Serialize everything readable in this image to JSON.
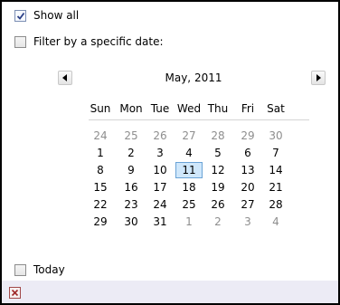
{
  "options": {
    "show_all": {
      "label": "Show all",
      "checked": true
    },
    "filter_by_date": {
      "label": "Filter by a specific date:",
      "checked": false
    },
    "today": {
      "label": "Today",
      "checked": false
    }
  },
  "calendar": {
    "month_label": "May, 2011",
    "weekdays": [
      "Sun",
      "Mon",
      "Tue",
      "Wed",
      "Thu",
      "Fri",
      "Sat"
    ],
    "selected_day": "11",
    "weeks": [
      [
        {
          "d": "24",
          "o": true
        },
        {
          "d": "25",
          "o": true
        },
        {
          "d": "26",
          "o": true
        },
        {
          "d": "27",
          "o": true
        },
        {
          "d": "28",
          "o": true
        },
        {
          "d": "29",
          "o": true
        },
        {
          "d": "30",
          "o": true
        }
      ],
      [
        {
          "d": "1"
        },
        {
          "d": "2"
        },
        {
          "d": "3"
        },
        {
          "d": "4"
        },
        {
          "d": "5"
        },
        {
          "d": "6"
        },
        {
          "d": "7"
        }
      ],
      [
        {
          "d": "8"
        },
        {
          "d": "9"
        },
        {
          "d": "10"
        },
        {
          "d": "11",
          "sel": true
        },
        {
          "d": "12"
        },
        {
          "d": "13"
        },
        {
          "d": "14"
        }
      ],
      [
        {
          "d": "15"
        },
        {
          "d": "16"
        },
        {
          "d": "17"
        },
        {
          "d": "18"
        },
        {
          "d": "19"
        },
        {
          "d": "20"
        },
        {
          "d": "21"
        }
      ],
      [
        {
          "d": "22"
        },
        {
          "d": "23"
        },
        {
          "d": "24"
        },
        {
          "d": "25"
        },
        {
          "d": "26"
        },
        {
          "d": "27"
        },
        {
          "d": "28"
        }
      ],
      [
        {
          "d": "29"
        },
        {
          "d": "30"
        },
        {
          "d": "31"
        },
        {
          "d": "1",
          "o": true
        },
        {
          "d": "2",
          "o": true
        },
        {
          "d": "3",
          "o": true
        },
        {
          "d": "4",
          "o": true
        }
      ]
    ]
  },
  "icons": {
    "prev": "chevron-left-icon",
    "next": "chevron-right-icon",
    "close": "close-icon"
  },
  "colors": {
    "selected_day_bg": "#cfe7fb",
    "selected_day_border": "#6aa3d6",
    "other_month_text": "#8e8e8e",
    "footer_bg": "#ecebf5"
  }
}
